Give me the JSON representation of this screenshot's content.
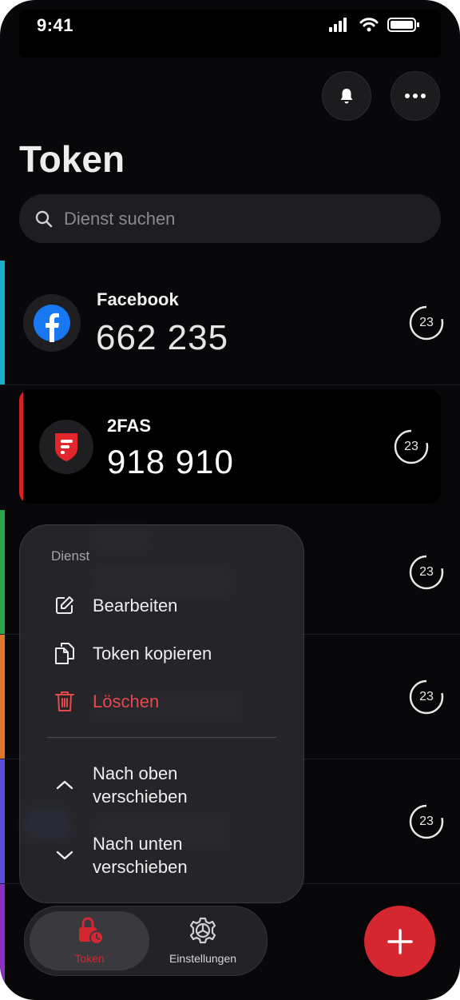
{
  "status_bar": {
    "time": "9:41"
  },
  "header": {
    "title": "Token",
    "bell_icon": "bell-icon",
    "more_icon": "ellipsis-icon"
  },
  "search": {
    "placeholder": "Dienst suchen",
    "icon": "search-icon"
  },
  "tokens": [
    {
      "service": "Facebook",
      "code": "662 235",
      "seconds": "23",
      "accent": "#1ab0c8"
    },
    {
      "service": "2FAS",
      "code": "918 910",
      "seconds": "23",
      "accent": "#d91f26"
    },
    {
      "seconds": "23",
      "accent": "#2aa64a"
    },
    {
      "seconds": "23",
      "accent": "#e0782a"
    },
    {
      "seconds": "23",
      "accent": "#5a4fd8"
    }
  ],
  "context_menu": {
    "title": "Dienst",
    "items": [
      {
        "label": "Bearbeiten",
        "icon": "edit-icon"
      },
      {
        "label": "Token kopieren",
        "icon": "copy-icon"
      },
      {
        "label": "Löschen",
        "icon": "trash-icon",
        "color": "#e5484d"
      },
      {
        "label": "Nach oben\nverschieben",
        "icon": "chevron-up-icon"
      },
      {
        "label": "Nach unten\nverschieben",
        "icon": "chevron-down-icon"
      }
    ]
  },
  "tabbar": {
    "tabs": [
      {
        "label": "Token",
        "icon": "lock-clock-icon",
        "active": true,
        "color": "#d62731"
      },
      {
        "label": "Einstellungen",
        "icon": "gear-icon",
        "active": false
      }
    ]
  },
  "fab": {
    "icon": "plus-icon",
    "color": "#d62731"
  }
}
